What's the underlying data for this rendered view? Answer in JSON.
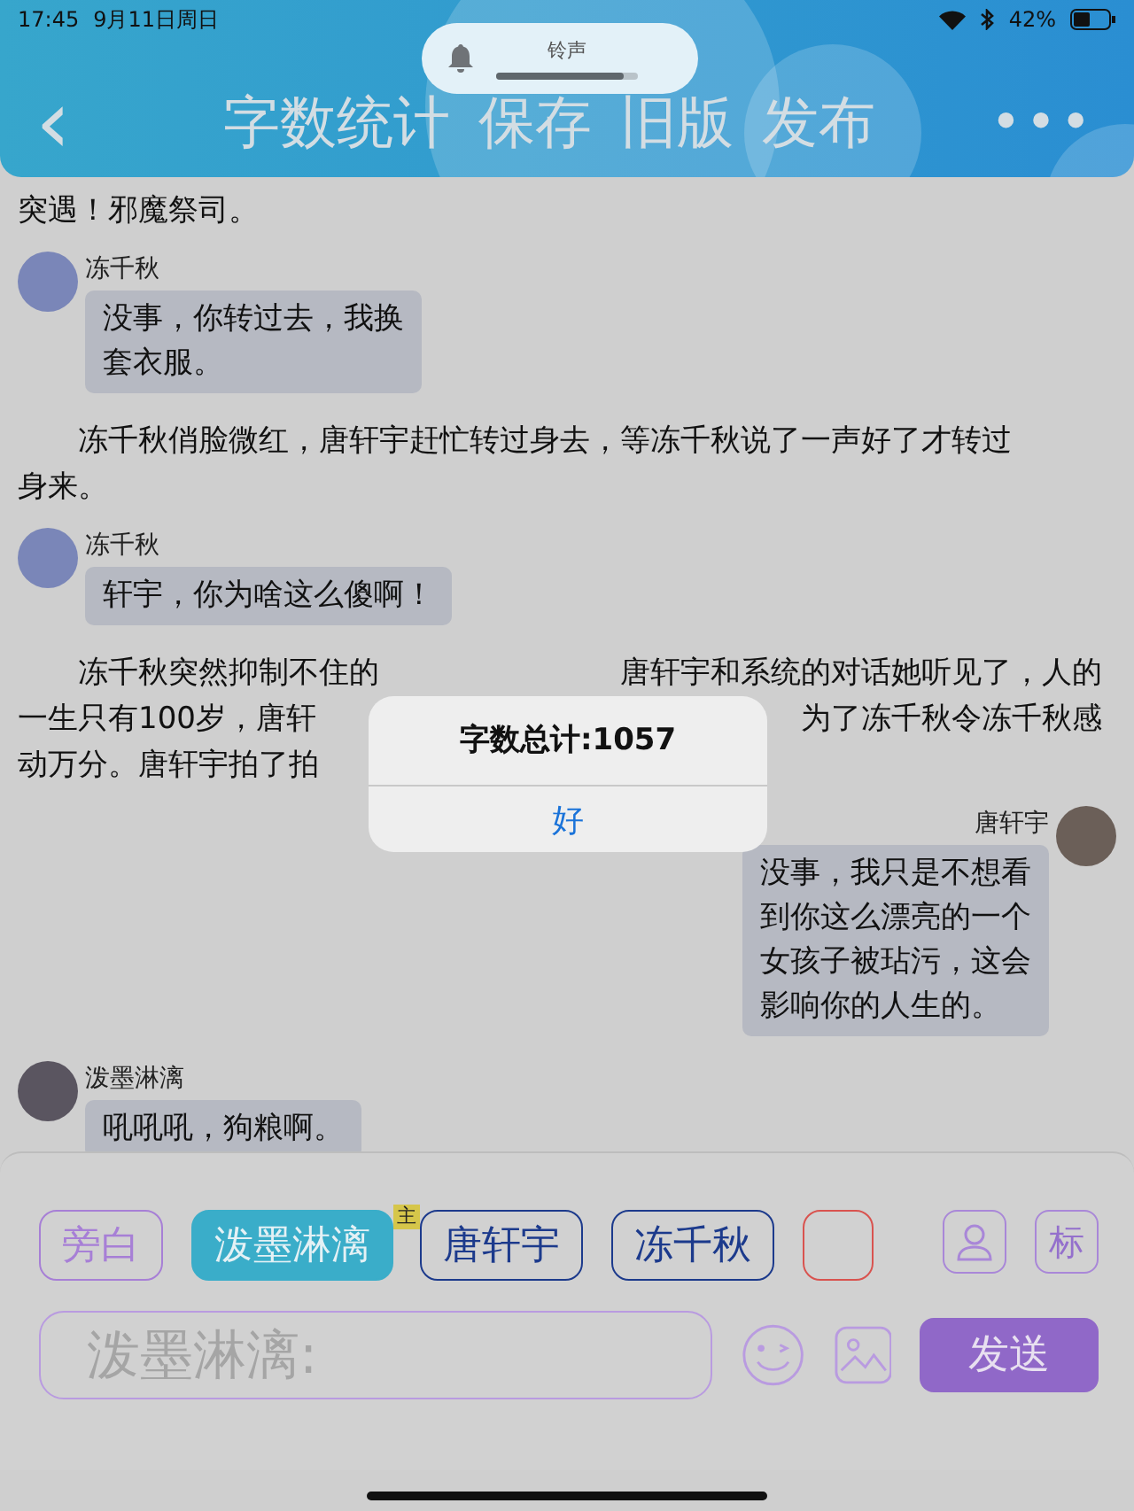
{
  "status_bar": {
    "time": "17:45",
    "date": "9月11日周日",
    "battery": "42%"
  },
  "header": {
    "back": "‹",
    "actions": [
      "字数统计",
      "保存",
      "旧版",
      "发布"
    ],
    "more": "•••"
  },
  "ringer": {
    "label": "铃声",
    "level": 0.9
  },
  "messages": [
    {
      "kind": "narration",
      "lines": [
        {
          "left": "突遇！邪魔祭司。"
        }
      ]
    },
    {
      "kind": "incoming",
      "name": "冻千秋",
      "lines": [
        "没事，你转过去，我换",
        "套衣服。"
      ],
      "color": "#7a86b8"
    },
    {
      "kind": "narration",
      "lines": [
        {
          "left": "　　冻千秋俏脸微红，唐轩宇赶忙转过身去，等冻千秋说了一声好了才转过"
        },
        {
          "left": "身来。"
        }
      ]
    },
    {
      "kind": "incoming",
      "name": "冻千秋",
      "lines": [
        "轩宇，你为啥这么傻啊！"
      ],
      "color": "#7a86b8"
    },
    {
      "kind": "narration",
      "lines": [
        {
          "left": "　　冻千秋突然抑制不住的",
          "right": "唐轩宇和系统的对话她听见了，人的"
        },
        {
          "left": "一生只有100岁，唐轩",
          "right": "为了冻千秋令冻千秋感"
        },
        {
          "left": "动万分。唐轩宇拍了拍"
        }
      ]
    },
    {
      "kind": "outgoing",
      "name": "唐轩宇",
      "lines": [
        "没事，我只是不想看",
        "到你这么漂亮的一个",
        "女孩子被玷污，这会",
        "影响你的人生的。"
      ],
      "color": "#6b5f58"
    },
    {
      "kind": "incoming",
      "name": "泼墨淋漓",
      "lines": [
        "吼吼吼，狗粮啊。"
      ],
      "color": "#5a5560"
    }
  ],
  "roles": [
    {
      "label": "旁白",
      "selected": false,
      "color": "#a77fd6"
    },
    {
      "label": "泼墨淋漓",
      "selected": true,
      "color": "#3aadc9",
      "badge": "主"
    },
    {
      "label": "唐轩宇",
      "selected": false,
      "color": "#1c3a8c"
    },
    {
      "label": "冻千秋",
      "selected": false,
      "color": "#1c3a8c"
    },
    {
      "selected": false,
      "color": "#d9534f"
    }
  ],
  "tag_button": "标",
  "input": {
    "placeholder": "泼墨淋漓:"
  },
  "send": "发送",
  "alert": {
    "message": "字数总计:1057",
    "button": "好"
  }
}
